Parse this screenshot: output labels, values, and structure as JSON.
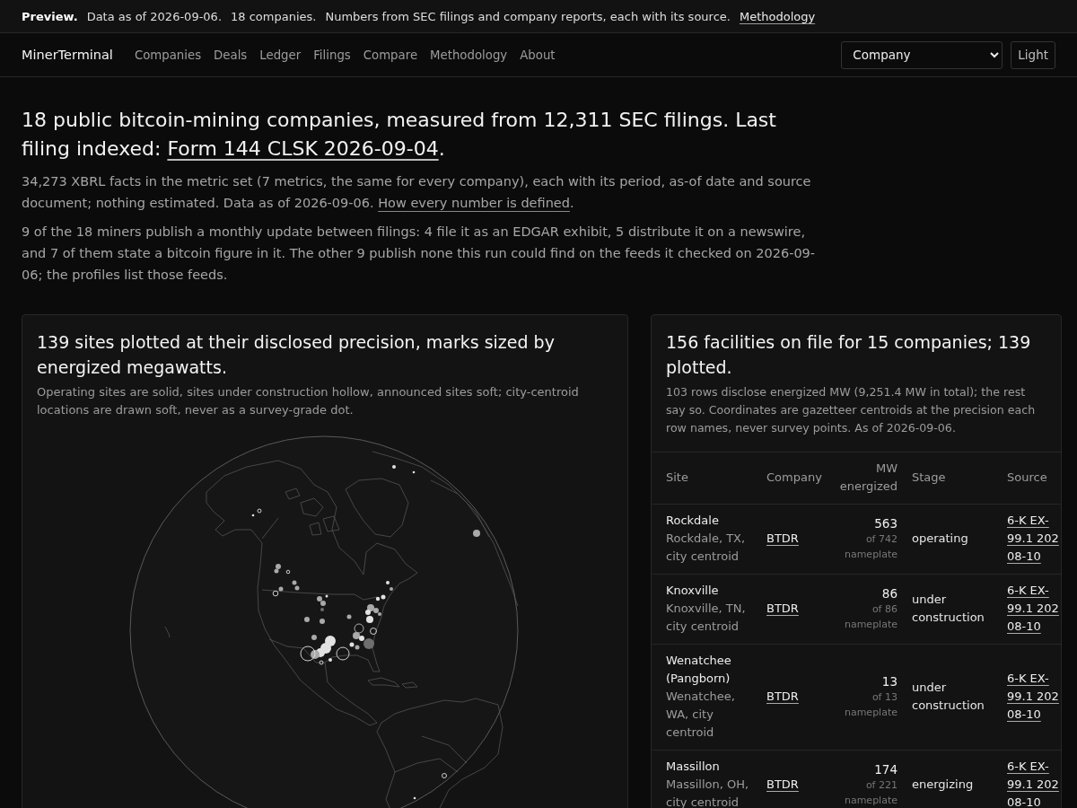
{
  "preview_bar": {
    "label": "Preview.",
    "items": [
      "Data as of 2026-09-06.",
      "18 companies.",
      "Numbers from SEC filings and company reports, each with its source."
    ],
    "link": "Methodology"
  },
  "nav": {
    "brand": "MinerTerminal",
    "links": [
      {
        "label": "Companies",
        "selected": false
      },
      {
        "label": "Deals",
        "selected": false
      },
      {
        "label": "Ledger",
        "selected": false
      },
      {
        "label": "Filings",
        "selected": false
      },
      {
        "label": "Compare",
        "selected": false
      },
      {
        "label": "Methodology",
        "selected": false
      },
      {
        "label": "About",
        "selected": false
      }
    ],
    "select": {
      "value": "Company"
    },
    "theme_button": "Light"
  },
  "intro": {
    "headline": {
      "text": "18 public bitcoin-mining companies, measured from 12,311 SEC filings. Last filing indexed:",
      "link": "Form 144 CLSK 2026-09-04",
      "after": "."
    },
    "paragraphs": [
      {
        "text": "34,273 XBRL facts in the metric set (7 metrics, the same for every company), each with its period, as-of date and source document; nothing estimated. Data as of 2026-09-06.",
        "link": "How every number is defined",
        "after": "."
      },
      {
        "text": "9 of the 18 miners publish a monthly update between filings: 4 file it as an EDGAR exhibit, 5 distribute it on a newswire, and 7 of them state a bitcoin figure in it. The other 9 publish none this run could find on the feeds it checked on 2026-09-06; the profiles list those feeds."
      }
    ]
  },
  "map_card": {
    "title": "139 sites plotted at their disclosed precision, marks sized by energized megawatts.",
    "note": "Operating sites are solid, sites under construction hollow, announced sites soft; city-centroid locations are drawn soft, never as a survey-grade dot."
  },
  "facilities_card": {
    "title": "156 facilities on file for 15 companies; 139 plotted.",
    "note": "103 rows disclose energized MW (9,251.4 MW in total); the rest say so. Coordinates are gazetteer centroids at the precision each row names, never survey points. As of 2026-09-06.",
    "table": {
      "columns": [
        "Site",
        "Company",
        "MW energized",
        "Stage",
        "Source"
      ],
      "rows": [
        {
          "site": "Rockdale",
          "location": "Rockdale, TX, city centroid",
          "company": "BTDR",
          "mw": "563",
          "nameplate": "of 742 nameplate",
          "stage": "operating",
          "source": "6-K EX-99.1 202 08-10"
        },
        {
          "site": "Knoxville",
          "location": "Knoxville, TN, city centroid",
          "company": "BTDR",
          "mw": "86",
          "nameplate": "of 86 nameplate",
          "stage": "under construction",
          "source": "6-K EX-99.1 202 08-10"
        },
        {
          "site": "Wenatchee (Pangborn)",
          "location": "Wenatchee, WA, city centroid",
          "company": "BTDR",
          "mw": "13",
          "nameplate": "of 13 nameplate",
          "stage": "under construction",
          "source": "6-K EX-99.1 202 08-10"
        },
        {
          "site": "Massillon",
          "location": "Massillon, OH, city centroid",
          "company": "BTDR",
          "mw": "174",
          "nameplate": "of 221 nameplate",
          "stage": "energizing",
          "source": "6-K EX-99.1 202 08-10"
        }
      ]
    }
  }
}
